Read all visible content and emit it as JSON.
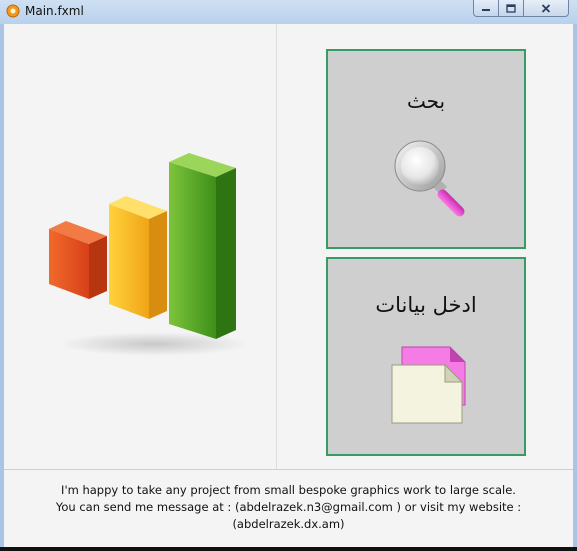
{
  "window": {
    "title": "Main.fxml",
    "accent": "#3a9a63"
  },
  "tiles": {
    "search": {
      "label": "بحث",
      "icon": "magnifier-icon"
    },
    "data_entry": {
      "label": "ادخل بيانات",
      "icon": "documents-icon"
    }
  },
  "illustration": {
    "icon": "bar-chart-icon"
  },
  "footer": {
    "line1": "I'm happy to take any project from small bespoke graphics work to large scale.",
    "line2": "You can send me message at : (abdelrazek.n3@gmail.com ) or visit my website : (abdelrazek.dx.am)"
  }
}
